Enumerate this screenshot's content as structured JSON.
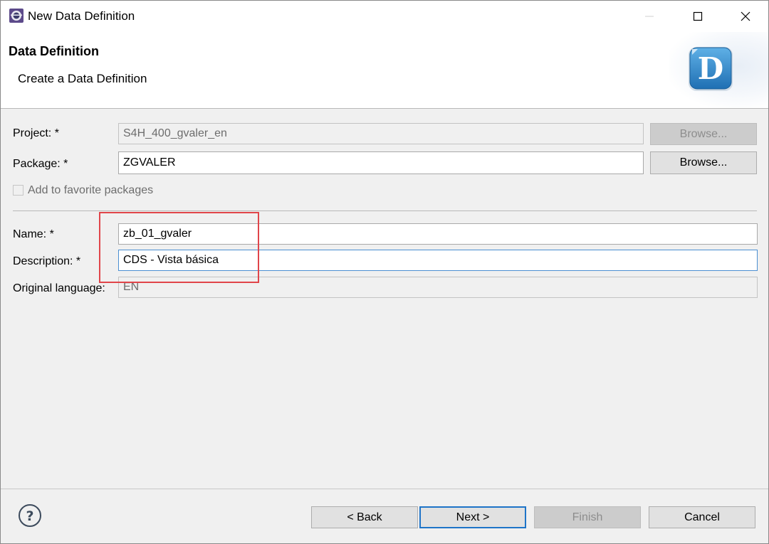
{
  "window": {
    "title": "New Data Definition",
    "controls": {
      "minimize_icon": "minimize-icon",
      "maximize_icon": "maximize-icon",
      "close_icon": "close-icon"
    }
  },
  "banner": {
    "title": "Data Definition",
    "message": "Create a Data Definition",
    "icon": "data-definition-d-icon"
  },
  "form": {
    "project": {
      "label": "Project: *",
      "value": "S4H_400_gvaler_en",
      "browse_label": "Browse..."
    },
    "package": {
      "label": "Package: *",
      "value": "ZGVALER",
      "browse_label": "Browse..."
    },
    "favorite": {
      "label": "Add to favorite packages",
      "checked": false
    },
    "name": {
      "label": "Name: *",
      "value": "zb_01_gvaler"
    },
    "description": {
      "label": "Description: *",
      "value": "CDS - Vista básica"
    },
    "original_language": {
      "label": "Original language:",
      "value": "EN"
    }
  },
  "annotation": {
    "highlight_color": "#e0454a"
  },
  "footer": {
    "help_icon": "help-icon",
    "back_label": "< Back",
    "next_label": "Next >",
    "finish_label": "Finish",
    "cancel_label": "Cancel"
  },
  "colors": {
    "accent": "#1e74c8",
    "focus_border": "#4b8fd1"
  }
}
